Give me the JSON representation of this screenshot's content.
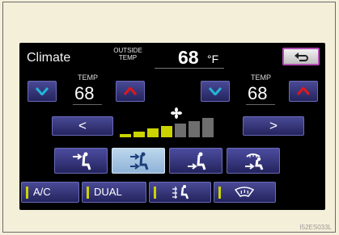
{
  "screen": {
    "title": "Climate",
    "outside": {
      "label": "OUTSIDE TEMP",
      "value": "68",
      "unit": "°F"
    },
    "driver": {
      "temp_label": "TEMP",
      "temp_value": "68"
    },
    "passenger": {
      "temp_label": "TEMP",
      "temp_value": "68"
    },
    "fan": {
      "prev_label": "<",
      "next_label": ">",
      "level": 4,
      "max_level": 7
    },
    "modes": [
      "face-vent-icon",
      "face-and-feet-icon",
      "feet-vent-icon",
      "feet-and-defrost-icon"
    ],
    "active_mode_index": 1,
    "bottom": {
      "ac_label": "A/C",
      "dual_label": "DUAL"
    }
  },
  "image_code": "I52ES033L",
  "colors": {
    "button": "#32327a",
    "button_active": "#a9c8e6",
    "fan_on": "#cbd300",
    "fan_off": "#6e6e6e",
    "warm_arrow": "#e01818",
    "cool_arrow": "#20b6d6",
    "return_border": "#b34db3"
  }
}
